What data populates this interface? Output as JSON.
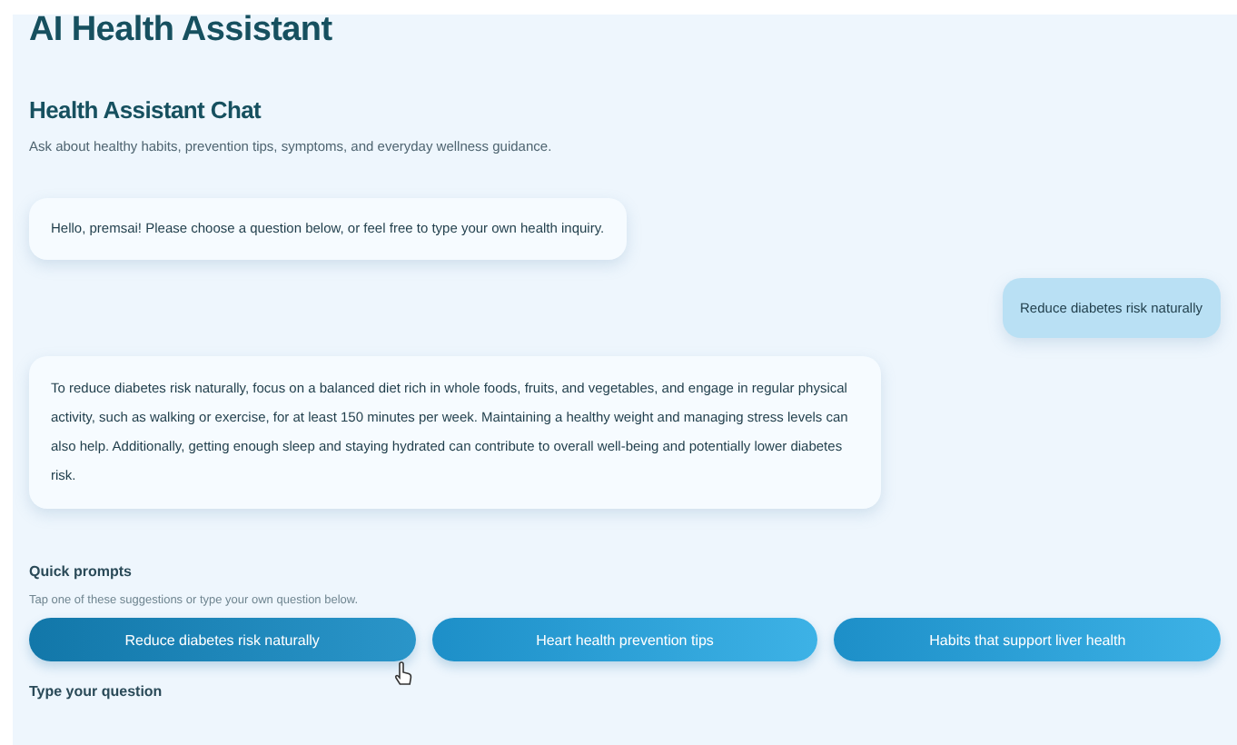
{
  "page_title": "AI Health Assistant",
  "chat": {
    "title": "Health Assistant Chat",
    "subtitle": "Ask about healthy habits, prevention tips, symptoms, and everyday wellness guidance.",
    "messages": [
      {
        "kind": "assistant",
        "text": "Hello, premsai! Please choose a question below, or feel free to type your own health inquiry."
      },
      {
        "kind": "user",
        "text": "Reduce diabetes risk naturally"
      },
      {
        "kind": "assistant",
        "text": "To reduce diabetes risk naturally, focus on a balanced diet rich in whole foods, fruits, and vegetables, and engage in regular physical activity, such as walking or exercise, for at least 150 minutes per week. Maintaining a healthy weight and managing stress levels can also help. Additionally, getting enough sleep and staying hydrated can contribute to overall well-being and potentially lower diabetes risk."
      }
    ]
  },
  "quick_prompts": {
    "title": "Quick prompts",
    "hint": "Tap one of these suggestions or type your own question below.",
    "buttons": [
      {
        "label": "Reduce diabetes risk naturally",
        "hovered": true
      },
      {
        "label": "Heart health prevention tips",
        "hovered": false
      },
      {
        "label": "Habits that support liver health",
        "hovered": false
      }
    ]
  },
  "input_label": "Type your question"
}
